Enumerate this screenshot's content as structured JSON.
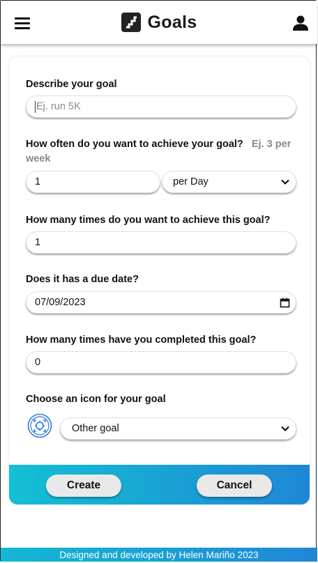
{
  "header": {
    "title": "Goals",
    "menu_icon": "hamburger-menu-icon",
    "logo_icon": "stairs-logo-icon",
    "user_icon": "user-icon"
  },
  "form": {
    "describe": {
      "label": "Describe your goal",
      "placeholder": "Ej. run 5K"
    },
    "frequency": {
      "label": "How often do you want to achieve your goal?",
      "hint": "Ej. 3 per week",
      "value": "1",
      "period_selected": "per Day"
    },
    "times": {
      "label": "How many times do you want to achieve this goal?",
      "value": "1"
    },
    "due_date": {
      "label": "Does it has a due date?",
      "value": "07/09/2023"
    },
    "completed": {
      "label": "How many times have you completed this goal?",
      "value": "0"
    },
    "icon": {
      "label": "Choose an icon for your goal",
      "selected": "Other goal",
      "preview_icon": "target-focus-icon"
    }
  },
  "actions": {
    "create_label": "Create",
    "cancel_label": "Cancel"
  },
  "footer": {
    "text": "Designed and developed by Helen Mariño 2023"
  },
  "colors": {
    "accent_start": "#13c0d4",
    "accent_end": "#1f87d6",
    "icon_blue": "#2a7bd6"
  }
}
